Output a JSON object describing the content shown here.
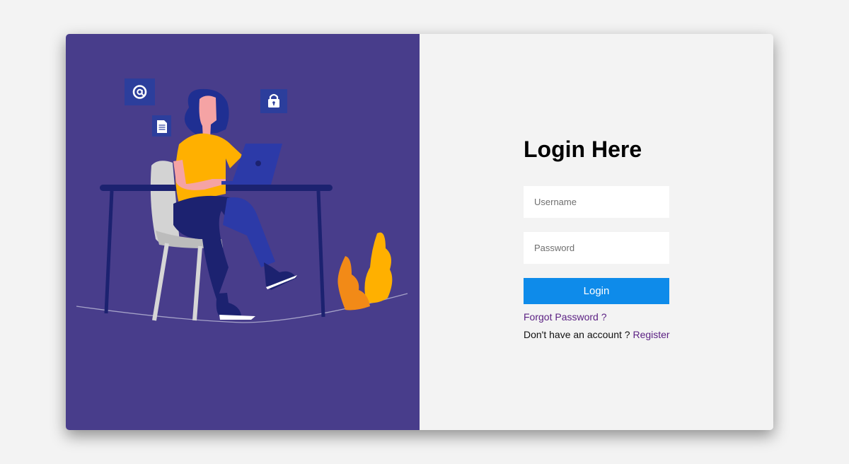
{
  "login": {
    "title": "Login Here",
    "username_placeholder": "Username",
    "password_placeholder": "Password",
    "button_label": "Login",
    "forgot_password": "Forgot Password ?",
    "no_account_text": "Don't have an account ?",
    "register_label": "Register"
  },
  "illustration": {
    "icons": [
      "at-sign-icon",
      "document-icon",
      "lock-icon"
    ],
    "subject": "woman-working-on-laptop"
  },
  "colors": {
    "page_background": "#f3f3f3",
    "illustration_background": "#483d8b",
    "form_background": "#f3f3f3",
    "primary_button": "#0e8bea",
    "link": "#5a1f82"
  }
}
